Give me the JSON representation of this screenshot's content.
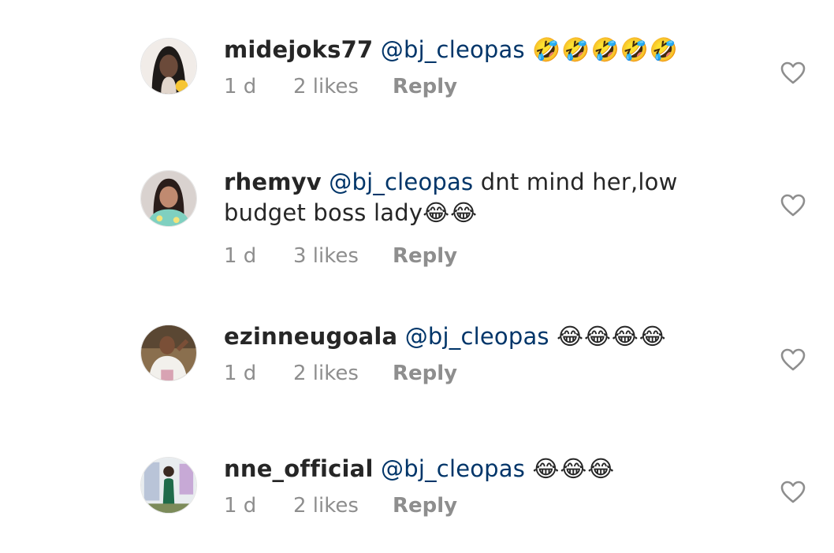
{
  "comments": [
    {
      "username": "midejoks77",
      "mention": "@bj_cleopas",
      "text": " ",
      "emojis": "🤣🤣🤣🤣🤣",
      "time": "1 d",
      "likes": "2 likes",
      "reply": "Reply",
      "avatar_color": "#3a2f2a"
    },
    {
      "username": "rhemyv",
      "mention": "@bj_cleopas",
      "text": " dnt mind her,low budget boss lady",
      "emojis": "😂😂",
      "time": "1 d",
      "likes": "3 likes",
      "reply": "Reply",
      "avatar_color": "#c9a58e"
    },
    {
      "username": "ezinneugoala",
      "mention": "@bj_cleopas",
      "text": " ",
      "emojis": "😂😂😂😂",
      "time": "1 d",
      "likes": "2 likes",
      "reply": "Reply",
      "avatar_color": "#6b5a45"
    },
    {
      "username": "nne_official",
      "mention": "@bj_cleopas",
      "text": " ",
      "emojis": "😂😂😂",
      "time": "1 d",
      "likes": "2 likes",
      "reply": "Reply",
      "avatar_color": "#2f6b4a"
    }
  ],
  "colors": {
    "text": "#262626",
    "mention": "#003569",
    "meta": "#8e8e8e"
  }
}
